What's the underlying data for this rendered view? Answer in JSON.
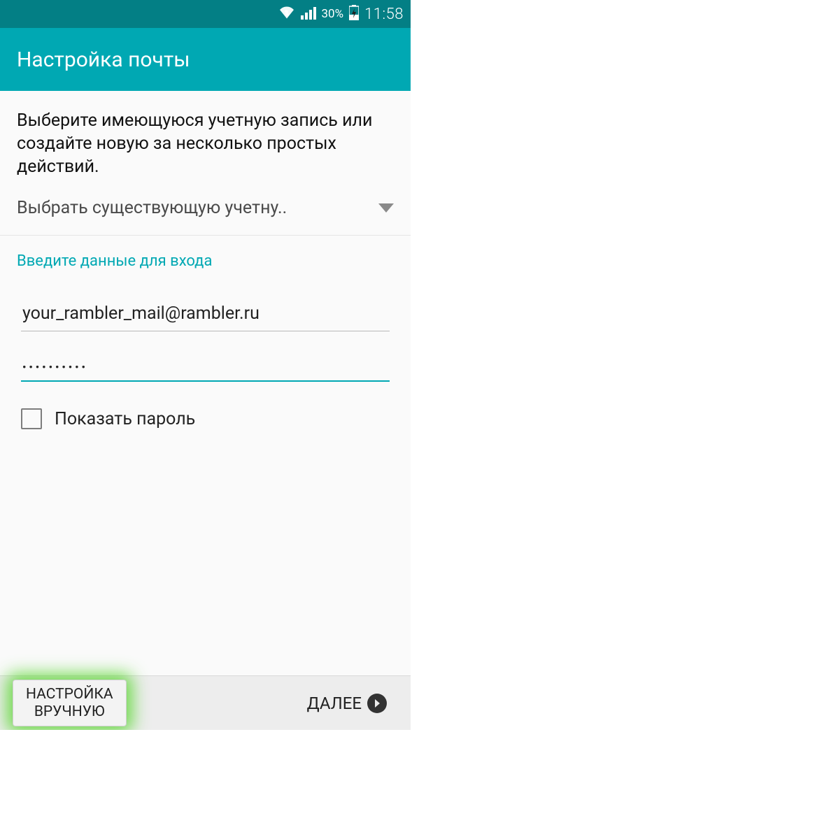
{
  "status_bar": {
    "battery_pct": "30%",
    "time": "11:58"
  },
  "header": {
    "title": "Настройка почты"
  },
  "intro": {
    "text": "Выберите имеющуюся учетную запись или создайте новую за несколько простых действий."
  },
  "dropdown": {
    "label": "Выбрать существующую учетну.."
  },
  "section": {
    "login_label": "Введите данные для входа"
  },
  "fields": {
    "email": "your_rambler_mail@rambler.ru",
    "password_masked": "••••••••••"
  },
  "checkbox": {
    "show_password": "Показать пароль"
  },
  "buttons": {
    "manual_line1": "НАСТРОЙКА",
    "manual_line2": "ВРУЧНУЮ",
    "next": "ДАЛЕЕ"
  },
  "colors": {
    "accent": "#00a8b3",
    "status_bar": "#037f85",
    "highlight_glow": "#56d62c"
  }
}
